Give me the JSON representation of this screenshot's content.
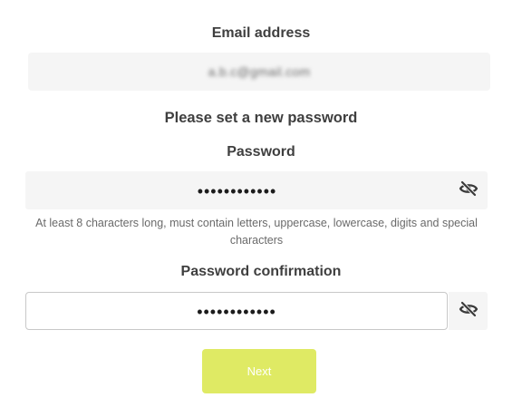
{
  "email": {
    "label": "Email address",
    "value": "a.b.c@gmail.com"
  },
  "heading": "Please set a new password",
  "password": {
    "label": "Password",
    "masked_value": "••••••••••••",
    "hint": "At least 8 characters long, must contain letters, uppercase, lowercase, digits and special characters",
    "toggle_icon": "eye-slash-icon"
  },
  "confirmation": {
    "label": "Password confirmation",
    "masked_value": "••••••••••••",
    "toggle_icon": "eye-slash-icon"
  },
  "next_button": {
    "label": "Next",
    "color": "#dfea64"
  }
}
